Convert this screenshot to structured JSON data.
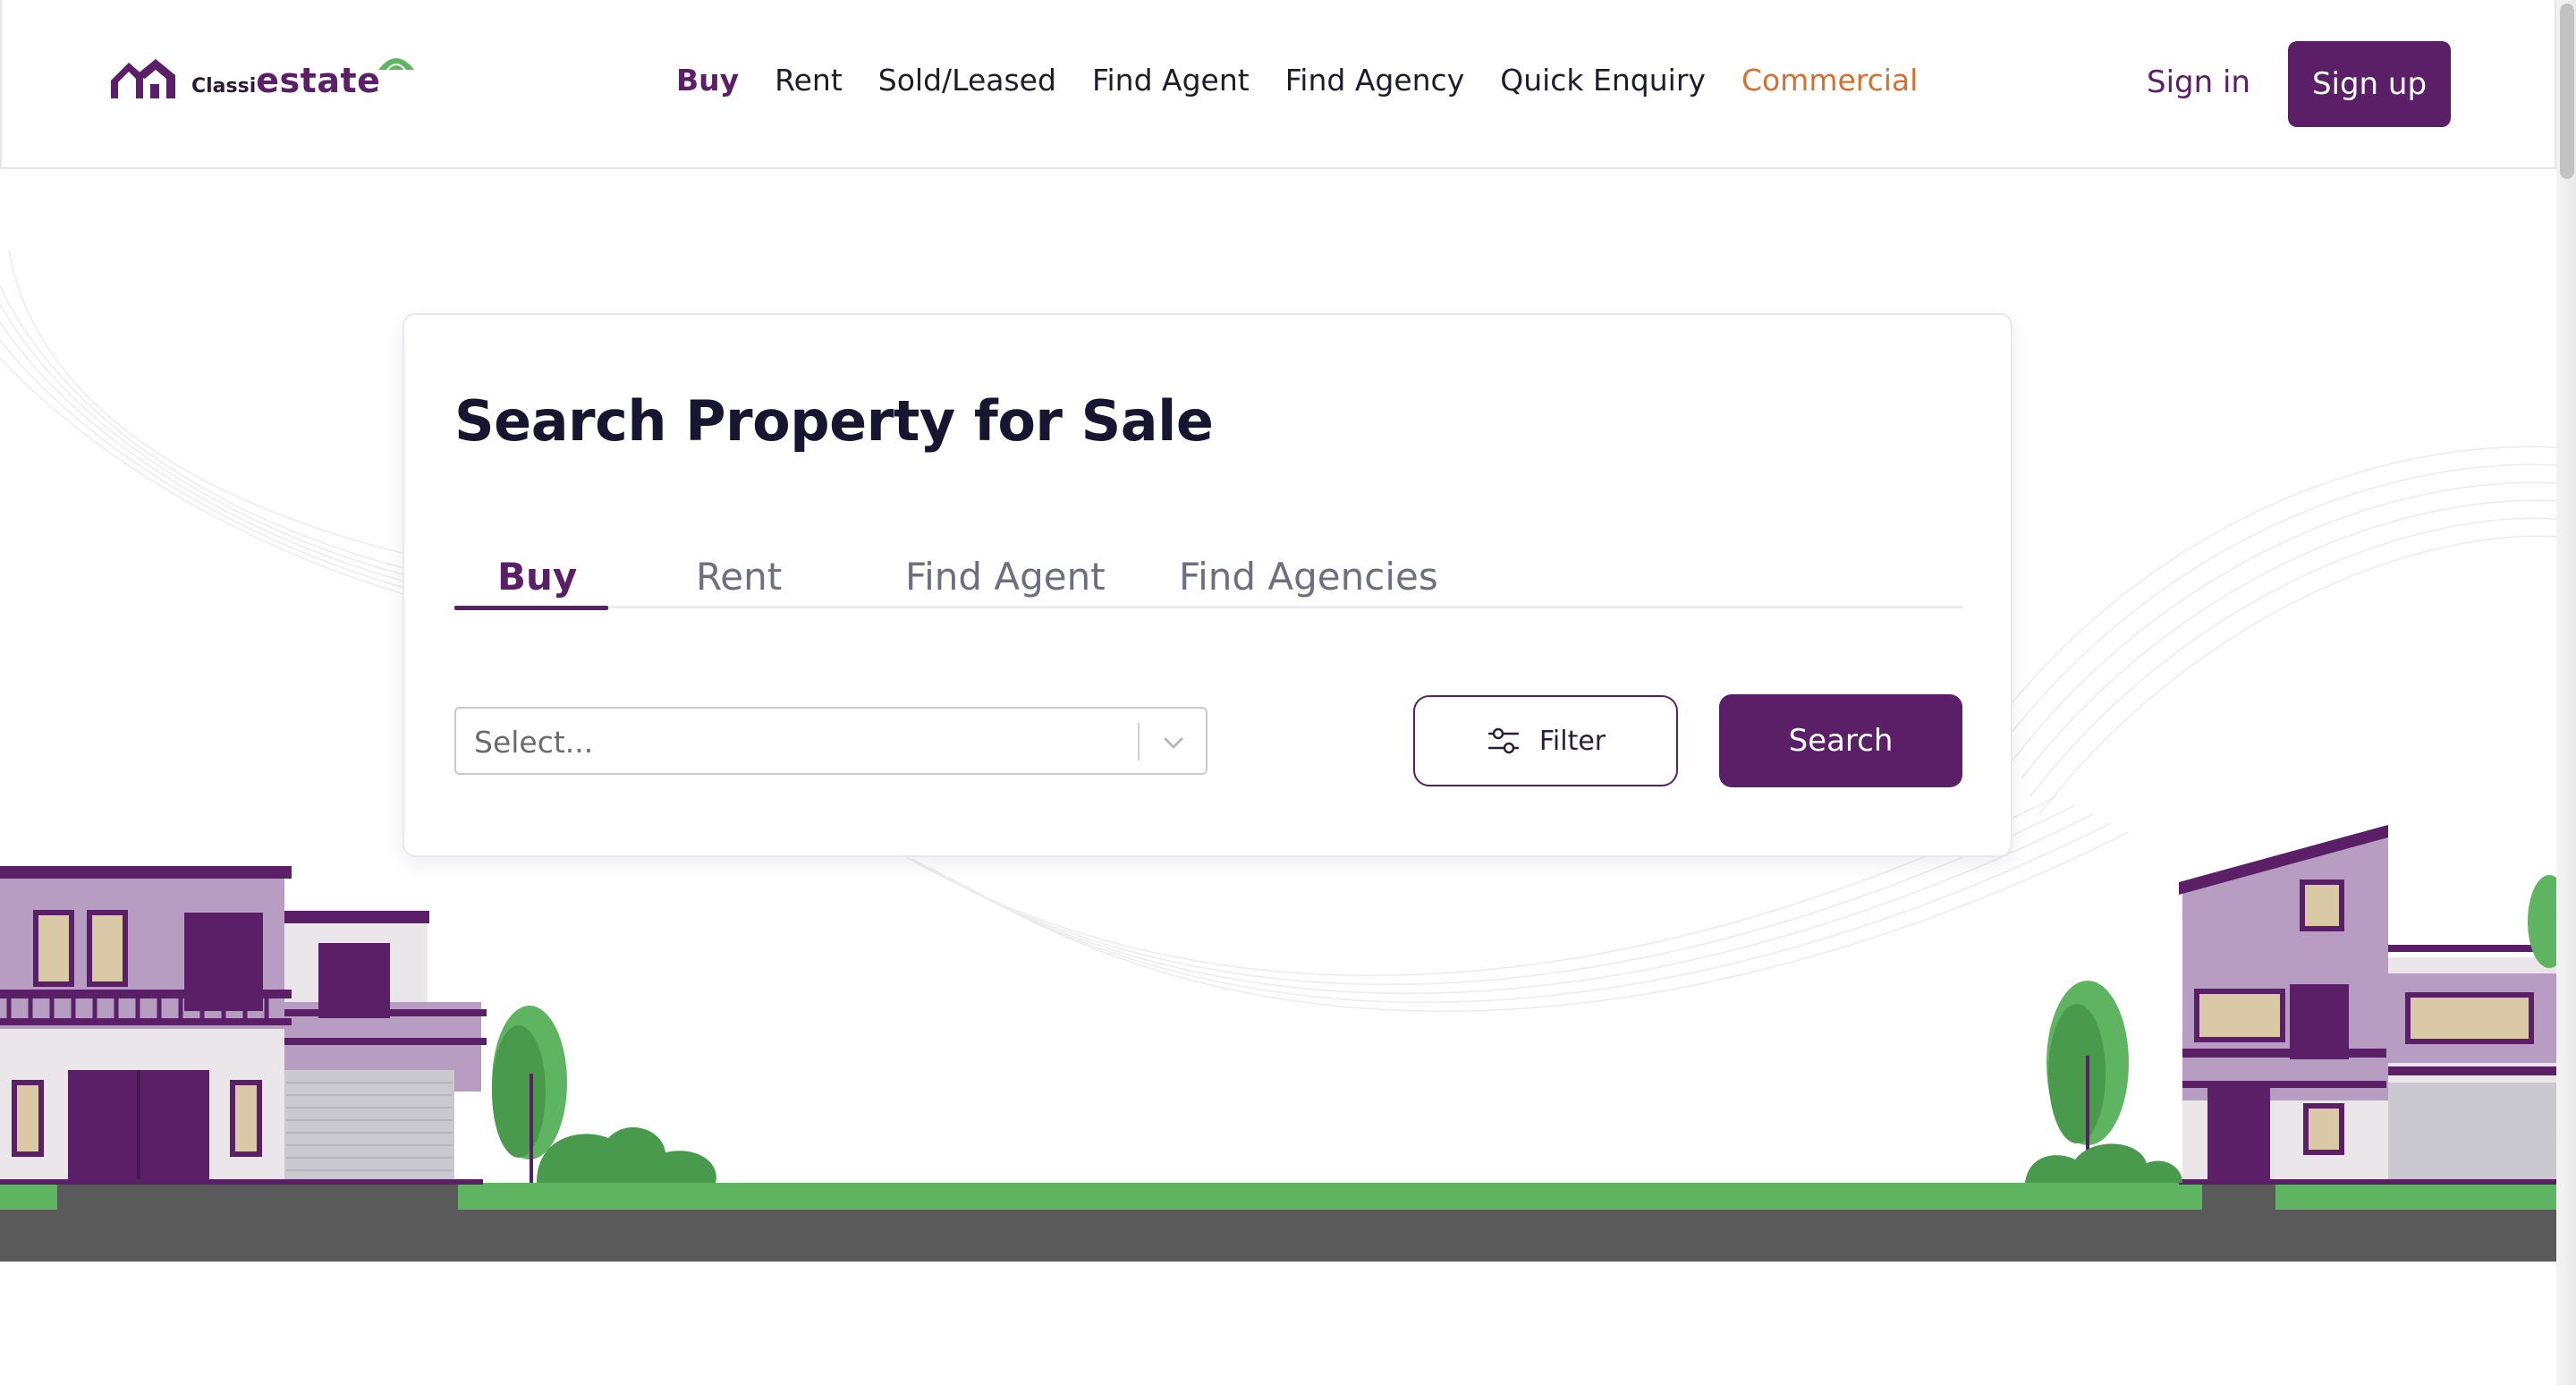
{
  "brand": {
    "logo_small": "Classi",
    "logo_big": "estate"
  },
  "nav": {
    "items": [
      {
        "label": "Buy"
      },
      {
        "label": "Rent"
      },
      {
        "label": "Sold/Leased"
      },
      {
        "label": "Find Agent"
      },
      {
        "label": "Find Agency"
      },
      {
        "label": "Quick Enquiry"
      },
      {
        "label": "Commercial"
      }
    ],
    "sign_in": "Sign in",
    "sign_up": "Sign up"
  },
  "search": {
    "title": "Search Property for Sale",
    "tabs": [
      {
        "label": "Buy"
      },
      {
        "label": "Rent"
      },
      {
        "label": "Find Agent"
      },
      {
        "label": "Find Agencies"
      }
    ],
    "select_placeholder": "Select...",
    "filter_label": "Filter",
    "search_label": "Search"
  },
  "colors": {
    "brand_purple": "#5a1f66",
    "accent_orange": "#d6702e",
    "grass_green": "#5fb461",
    "road_gray": "#5a5a5a"
  },
  "icons": {
    "logo": "house-roof-logo-icon",
    "filter": "sliders-icon",
    "dropdown": "chevron-down-icon"
  }
}
